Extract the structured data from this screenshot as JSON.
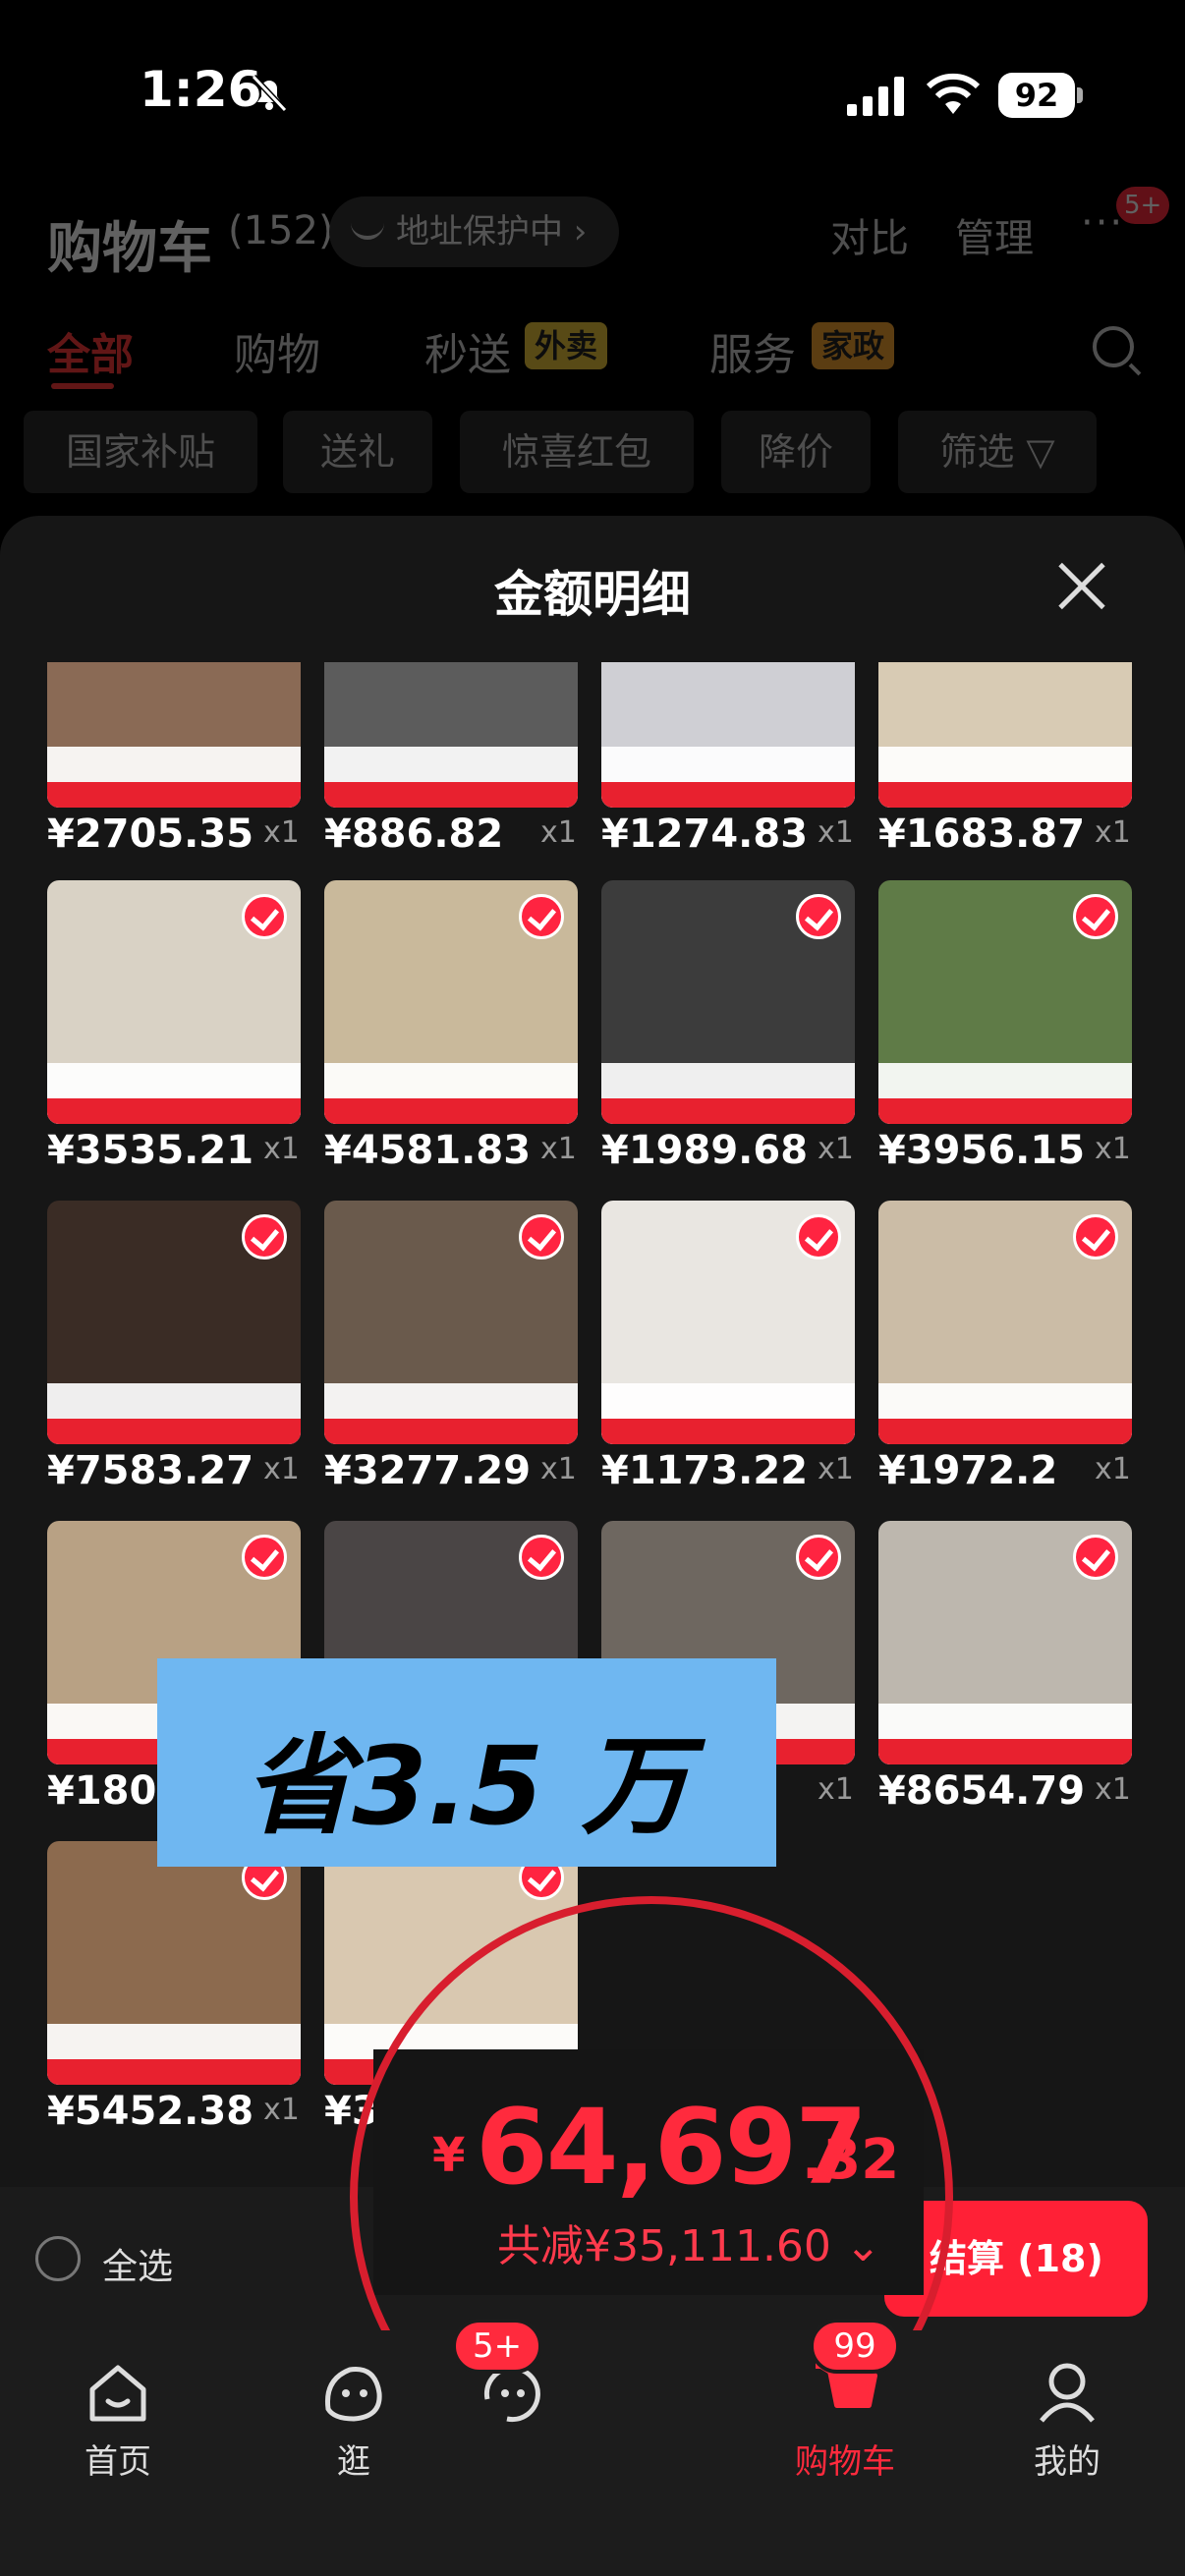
{
  "status_bar": {
    "time": "1:26",
    "battery": "92"
  },
  "header": {
    "title": "购物车",
    "count": "(152)",
    "address_pill": "地址保护中 ›",
    "compare": "对比",
    "manage": "管理",
    "more": "···",
    "more_badge": "5+"
  },
  "tabs": [
    {
      "label": "全部"
    },
    {
      "label": "购物"
    },
    {
      "label": "秒送",
      "badge": "外卖"
    },
    {
      "label": "服务",
      "badge": "家政"
    }
  ],
  "filter_chips": [
    "国家补贴",
    "送礼",
    "惊喜红包",
    "降价",
    "筛选 ▽"
  ],
  "sheet": {
    "title": "金额明细"
  },
  "items": [
    {
      "price": "¥2705.35",
      "qty": "x1",
      "color": "#8a6a55"
    },
    {
      "price": "¥886.82",
      "qty": "x1",
      "color": "#5c5c5c"
    },
    {
      "price": "¥1274.83",
      "qty": "x1",
      "color": "#cfcfd4"
    },
    {
      "price": "¥1683.87",
      "qty": "x1",
      "color": "#d8cbb4"
    },
    {
      "price": "¥3535.21",
      "qty": "x1",
      "color": "#d9d2c5"
    },
    {
      "price": "¥4581.83",
      "qty": "x1",
      "color": "#c9b99b"
    },
    {
      "price": "¥1989.68",
      "qty": "x1",
      "color": "#3c3c3c"
    },
    {
      "price": "¥3956.15",
      "qty": "x1",
      "color": "#5f7b47"
    },
    {
      "price": "¥7583.27",
      "qty": "x1",
      "color": "#3a2c25"
    },
    {
      "price": "¥3277.29",
      "qty": "x1",
      "color": "#6a5a4c"
    },
    {
      "price": "¥1173.22",
      "qty": "x1",
      "color": "#e9e6e1"
    },
    {
      "price": "¥1972.2",
      "qty": "x1",
      "color": "#cbbca6"
    },
    {
      "price": "¥1805",
      "qty": "",
      "color": "#b8a184"
    },
    {
      "price": "",
      "qty": "",
      "color": "#4a4545"
    },
    {
      "price": "",
      "qty": "x1",
      "color": "#6e6760"
    },
    {
      "price": "¥8654.79",
      "qty": "x1",
      "color": "#bdb7ae"
    },
    {
      "price": "¥5452.38",
      "qty": "x1",
      "color": "#8c6a4e"
    },
    {
      "price": "¥3",
      "qty": "",
      "color": "#d9c8b0"
    }
  ],
  "savings_banner": "省3.5 万",
  "checkout": {
    "select_all": "全选",
    "button": "结算 (18)"
  },
  "total": {
    "currency": "¥",
    "main": "64,697",
    "decimal": ".32",
    "saving": "共减¥35,111.60 ⌄"
  },
  "tabbar": [
    {
      "label": "首页"
    },
    {
      "label": "逛"
    },
    {
      "label": "",
      "badge": "5+"
    },
    {
      "label": "购物车",
      "badge": "99"
    },
    {
      "label": "我的"
    }
  ],
  "colors": {
    "accent": "#ff2a3d",
    "background": "#161616",
    "banner": "#6fb7f1"
  }
}
